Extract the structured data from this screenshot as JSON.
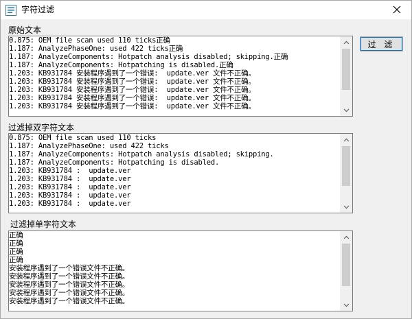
{
  "window": {
    "title": "字符过滤",
    "icon": "app-list-icon",
    "close_icon": "close-icon"
  },
  "filter_button": {
    "label": "过 滤"
  },
  "sections": {
    "original": {
      "label": "原始文本",
      "lines": [
        "0.875: OEM file scan used 110 ticks正确",
        "1.187: AnalyzePhaseOne: used 422 ticks正确",
        "1.187: AnalyzeComponents: Hotpatch analysis disabled; skipping.正确",
        "1.187: AnalyzeComponents: Hotpatching is disabled.正确",
        "1.203: KB931784 安装程序遇到了一个错误:  update.ver 文件不正确。",
        "1.203: KB931784 安装程序遇到了一个错误:  update.ver 文件不正确。",
        "1.203: KB931784 安装程序遇到了一个错误:  update.ver 文件不正确。",
        "1.203: KB931784 安装程序遇到了一个错误:  update.ver 文件不正确。",
        "1.203: KB931784 安装程序遇到了一个错误:  update.ver 文件不正确。"
      ]
    },
    "double_filtered": {
      "label": "过滤掉双字符文本",
      "lines": [
        "0.875: OEM file scan used 110 ticks",
        "1.187: AnalyzePhaseOne: used 422 ticks",
        "1.187: AnalyzeComponents: Hotpatch analysis disabled; skipping.",
        "1.187: AnalyzeComponents: Hotpatching is disabled.",
        "1.203: KB931784 :  update.ver",
        "1.203: KB931784 :  update.ver",
        "1.203: KB931784 :  update.ver",
        "1.203: KB931784 :  update.ver",
        "1.203: KB931784 :  update.ver"
      ]
    },
    "single_filtered": {
      "label": "过滤掉单字符文本",
      "lines": [
        "正确",
        "正确",
        "正确",
        "正确",
        "安装程序遇到了一个错误文件不正确。",
        "安装程序遇到了一个错误文件不正确。",
        "安装程序遇到了一个错误文件不正确。",
        "安装程序遇到了一个错误文件不正确。",
        "安装程序遇到了一个错误文件不正确。"
      ]
    }
  }
}
